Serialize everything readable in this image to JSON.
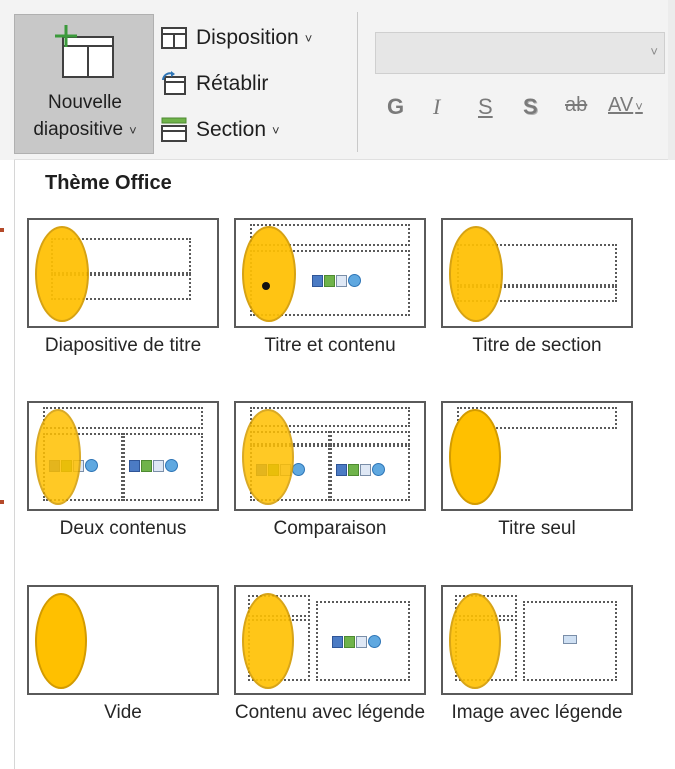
{
  "ribbon": {
    "new_slide": {
      "line1": "Nouvelle",
      "line2": "diapositive",
      "chevron": "˅"
    },
    "disposition": {
      "label": "Disposition",
      "chevron": "˅"
    },
    "retablir": {
      "label": "Rétablir"
    },
    "section": {
      "label": "Section",
      "chevron": "˅"
    },
    "font_box": {
      "value": "",
      "chevron": "˅"
    },
    "format": {
      "bold": "G",
      "italic": "I",
      "underline": "S",
      "shadow": "S",
      "strike": "ab",
      "spacing": "AV",
      "spacing_chevron": "˅"
    }
  },
  "gallery": {
    "title": "Thème Office",
    "layouts": [
      {
        "label": "Diapositive de titre"
      },
      {
        "label": "Titre et contenu"
      },
      {
        "label": "Titre de section"
      },
      {
        "label": "Deux contenus"
      },
      {
        "label": "Comparaison"
      },
      {
        "label": "Titre seul"
      },
      {
        "label": "Vide"
      },
      {
        "label": "Contenu avec légende"
      },
      {
        "label": "Image avec légende"
      }
    ]
  },
  "colors": {
    "accent_oval": "#ffc000",
    "ribbon_bg": "#f3f3f3",
    "selected_btn": "#c8c8c8"
  }
}
